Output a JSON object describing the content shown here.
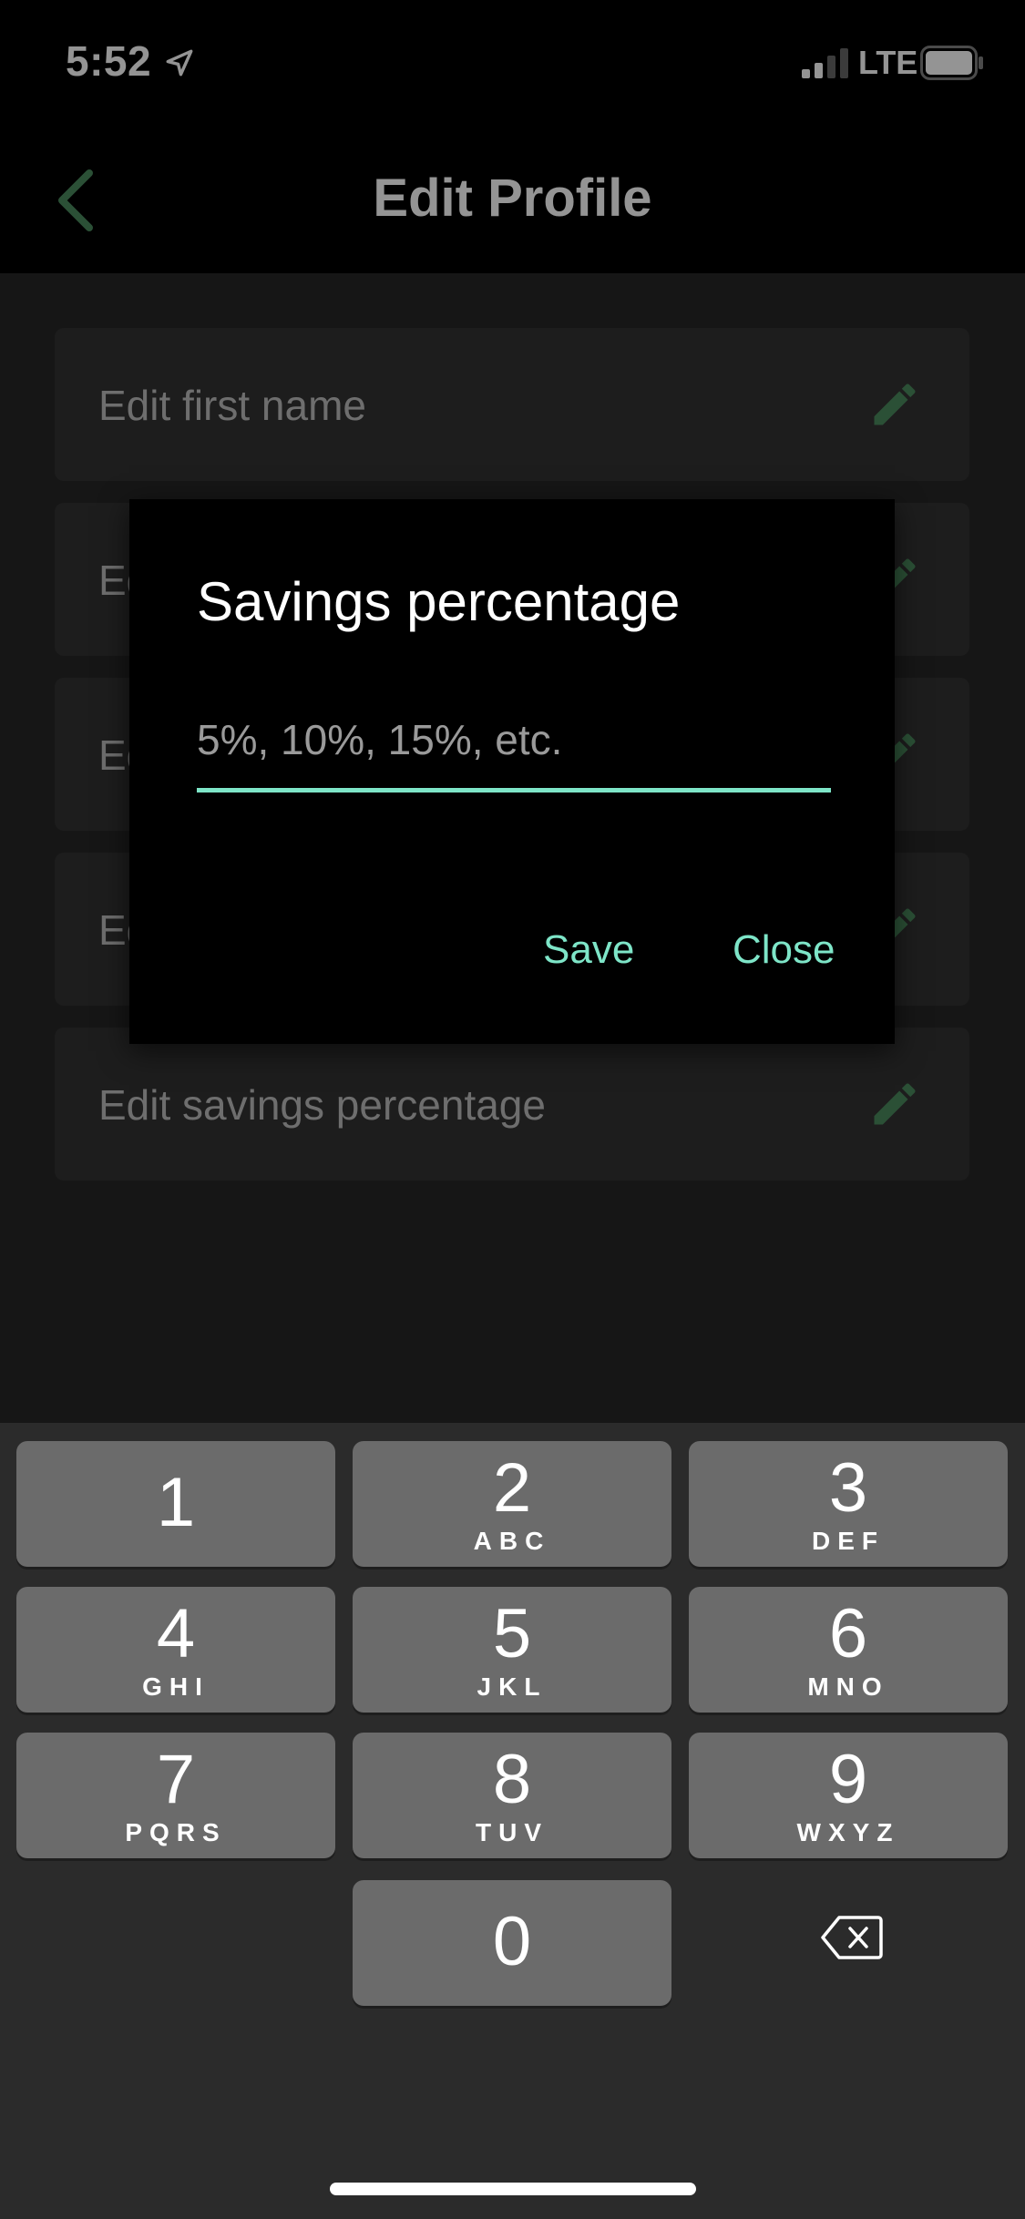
{
  "status_bar": {
    "time": "5:52",
    "network": "LTE",
    "icons": [
      "location-arrow-icon",
      "signal-bars-icon",
      "battery-icon"
    ]
  },
  "header": {
    "title": "Edit Profile",
    "back_icon": "chevron-left-icon"
  },
  "fields": [
    {
      "label": "Edit first name",
      "icon": "pencil-icon"
    },
    {
      "label": "Ed",
      "icon": "pencil-icon"
    },
    {
      "label": "Ed",
      "icon": "pencil-icon"
    },
    {
      "label": "Ed",
      "icon": "pencil-icon"
    },
    {
      "label": "Edit savings percentage",
      "icon": "pencil-icon"
    }
  ],
  "dialog": {
    "title": "Savings percentage",
    "input_placeholder": "5%, 10%, 15%, etc.",
    "input_value": "",
    "save_label": "Save",
    "close_label": "Close"
  },
  "keyboard": {
    "keys": [
      {
        "digit": "1",
        "letters": ""
      },
      {
        "digit": "2",
        "letters": "ABC"
      },
      {
        "digit": "3",
        "letters": "DEF"
      },
      {
        "digit": "4",
        "letters": "GHI"
      },
      {
        "digit": "5",
        "letters": "JKL"
      },
      {
        "digit": "6",
        "letters": "MNO"
      },
      {
        "digit": "7",
        "letters": "PQRS"
      },
      {
        "digit": "8",
        "letters": "TUV"
      },
      {
        "digit": "9",
        "letters": "WXYZ"
      },
      {
        "digit": "0",
        "letters": ""
      }
    ],
    "delete_icon": "backspace-icon"
  },
  "colors": {
    "accent": "#7ee5c8",
    "icon_green": "#4a8a5e",
    "dialog_bg": "#000000",
    "field_bg": "#333333",
    "key_bg": "#6b6b6b"
  }
}
